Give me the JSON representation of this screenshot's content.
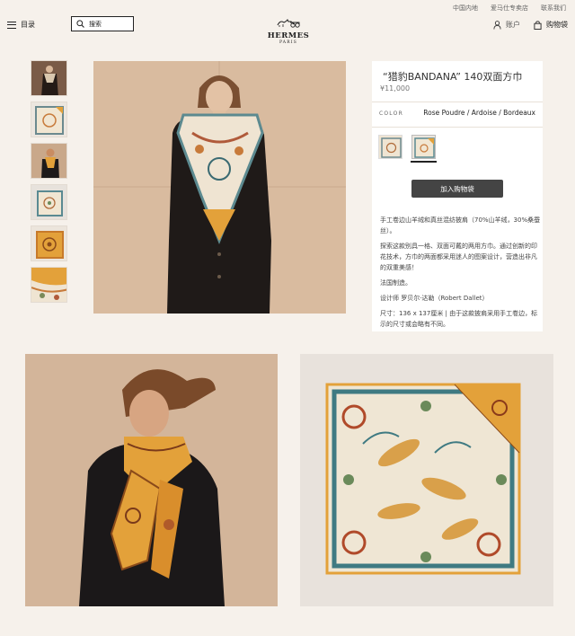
{
  "top_links": [
    "中国内地",
    "爱马仕专卖店",
    "联系我们"
  ],
  "header": {
    "menu_label": "目录",
    "search_placeholder": "搜索",
    "logo_name": "HERMES",
    "logo_city": "PARIS",
    "account_label": "账户",
    "cart_label": "购物袋"
  },
  "product": {
    "title": "“猎豹BANDANA” 140双面方巾",
    "price": "¥11,000",
    "color_label": "COLOR",
    "color_value": "Rose Poudre / Ardoise / Bordeaux",
    "add_to_bag": "加入购物袋",
    "description": [
      "手工卷边山羊绒和真丝混纺披肩（70%山羊绒，30%桑蚕丝）。",
      "探索这款别具一格、双面可戴的两用方巾。通过创新的印花技术，方巾的两面都采用迷人的图案设计，营造出非凡的双重美感！",
      "法国制造。",
      "设计师 罗贝尔·达勒（Robert Dallet）",
      "尺寸：136 x 137厘米 | 由于这款披肩采用手工卷边，标示的尺寸或会略有不同。"
    ]
  },
  "colors": {
    "background": "#f6f1eb",
    "button": "#444444",
    "scarf_orange": "#e3a13a",
    "scarf_cream": "#f1e6d2"
  }
}
